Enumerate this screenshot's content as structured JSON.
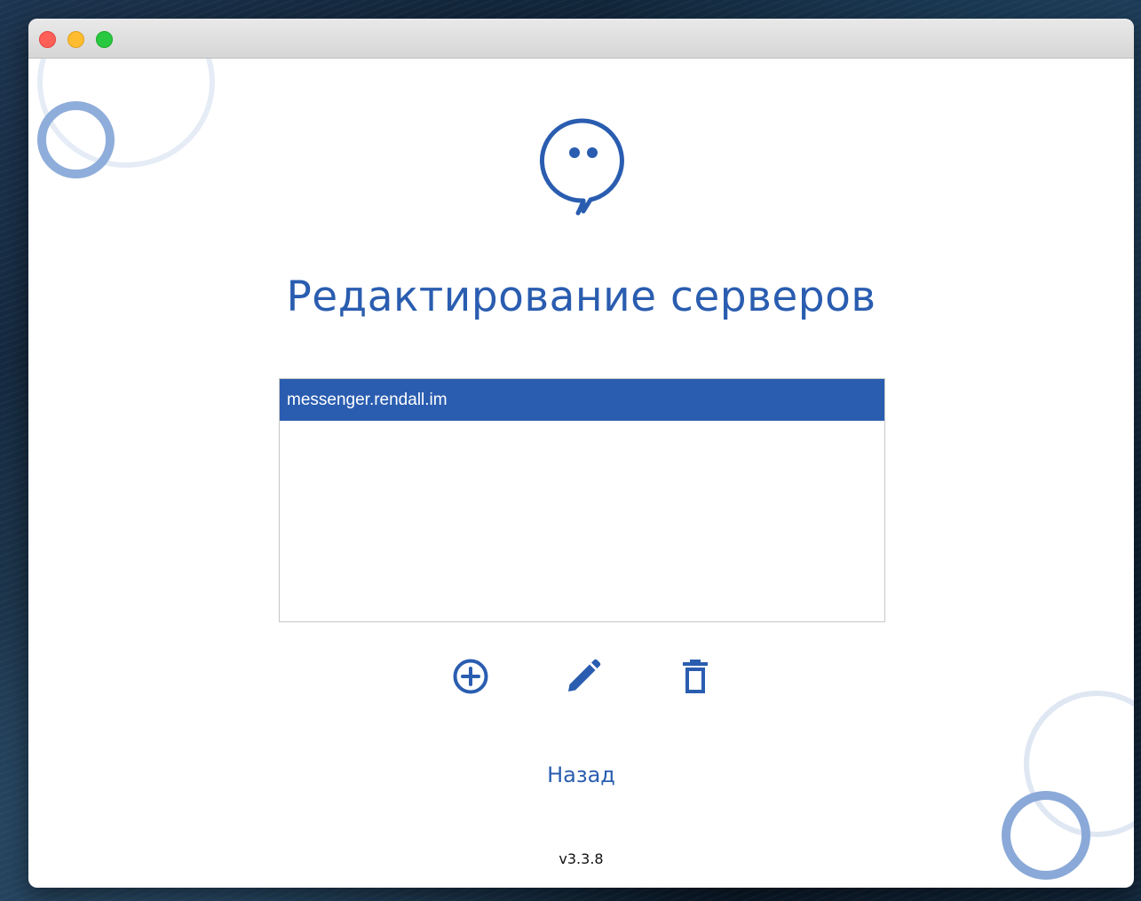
{
  "window": {
    "title": ""
  },
  "page": {
    "title": "Редактирование серверов",
    "logo_icon": "chat-bubble-icon"
  },
  "servers": {
    "items": [
      {
        "label": "messenger.rendall.im",
        "selected": true
      }
    ]
  },
  "actions": {
    "add_icon": "add-circle-icon",
    "edit_icon": "pencil-icon",
    "delete_icon": "trash-icon"
  },
  "footer": {
    "back_label": "Назад",
    "version": "v3.3.8"
  },
  "colors": {
    "accent": "#2a5db0",
    "selection_bg": "#2a5db0",
    "selection_text": "#ffffff",
    "decor_light": "#e5ecf6",
    "decor_mid": "#8eadda"
  }
}
